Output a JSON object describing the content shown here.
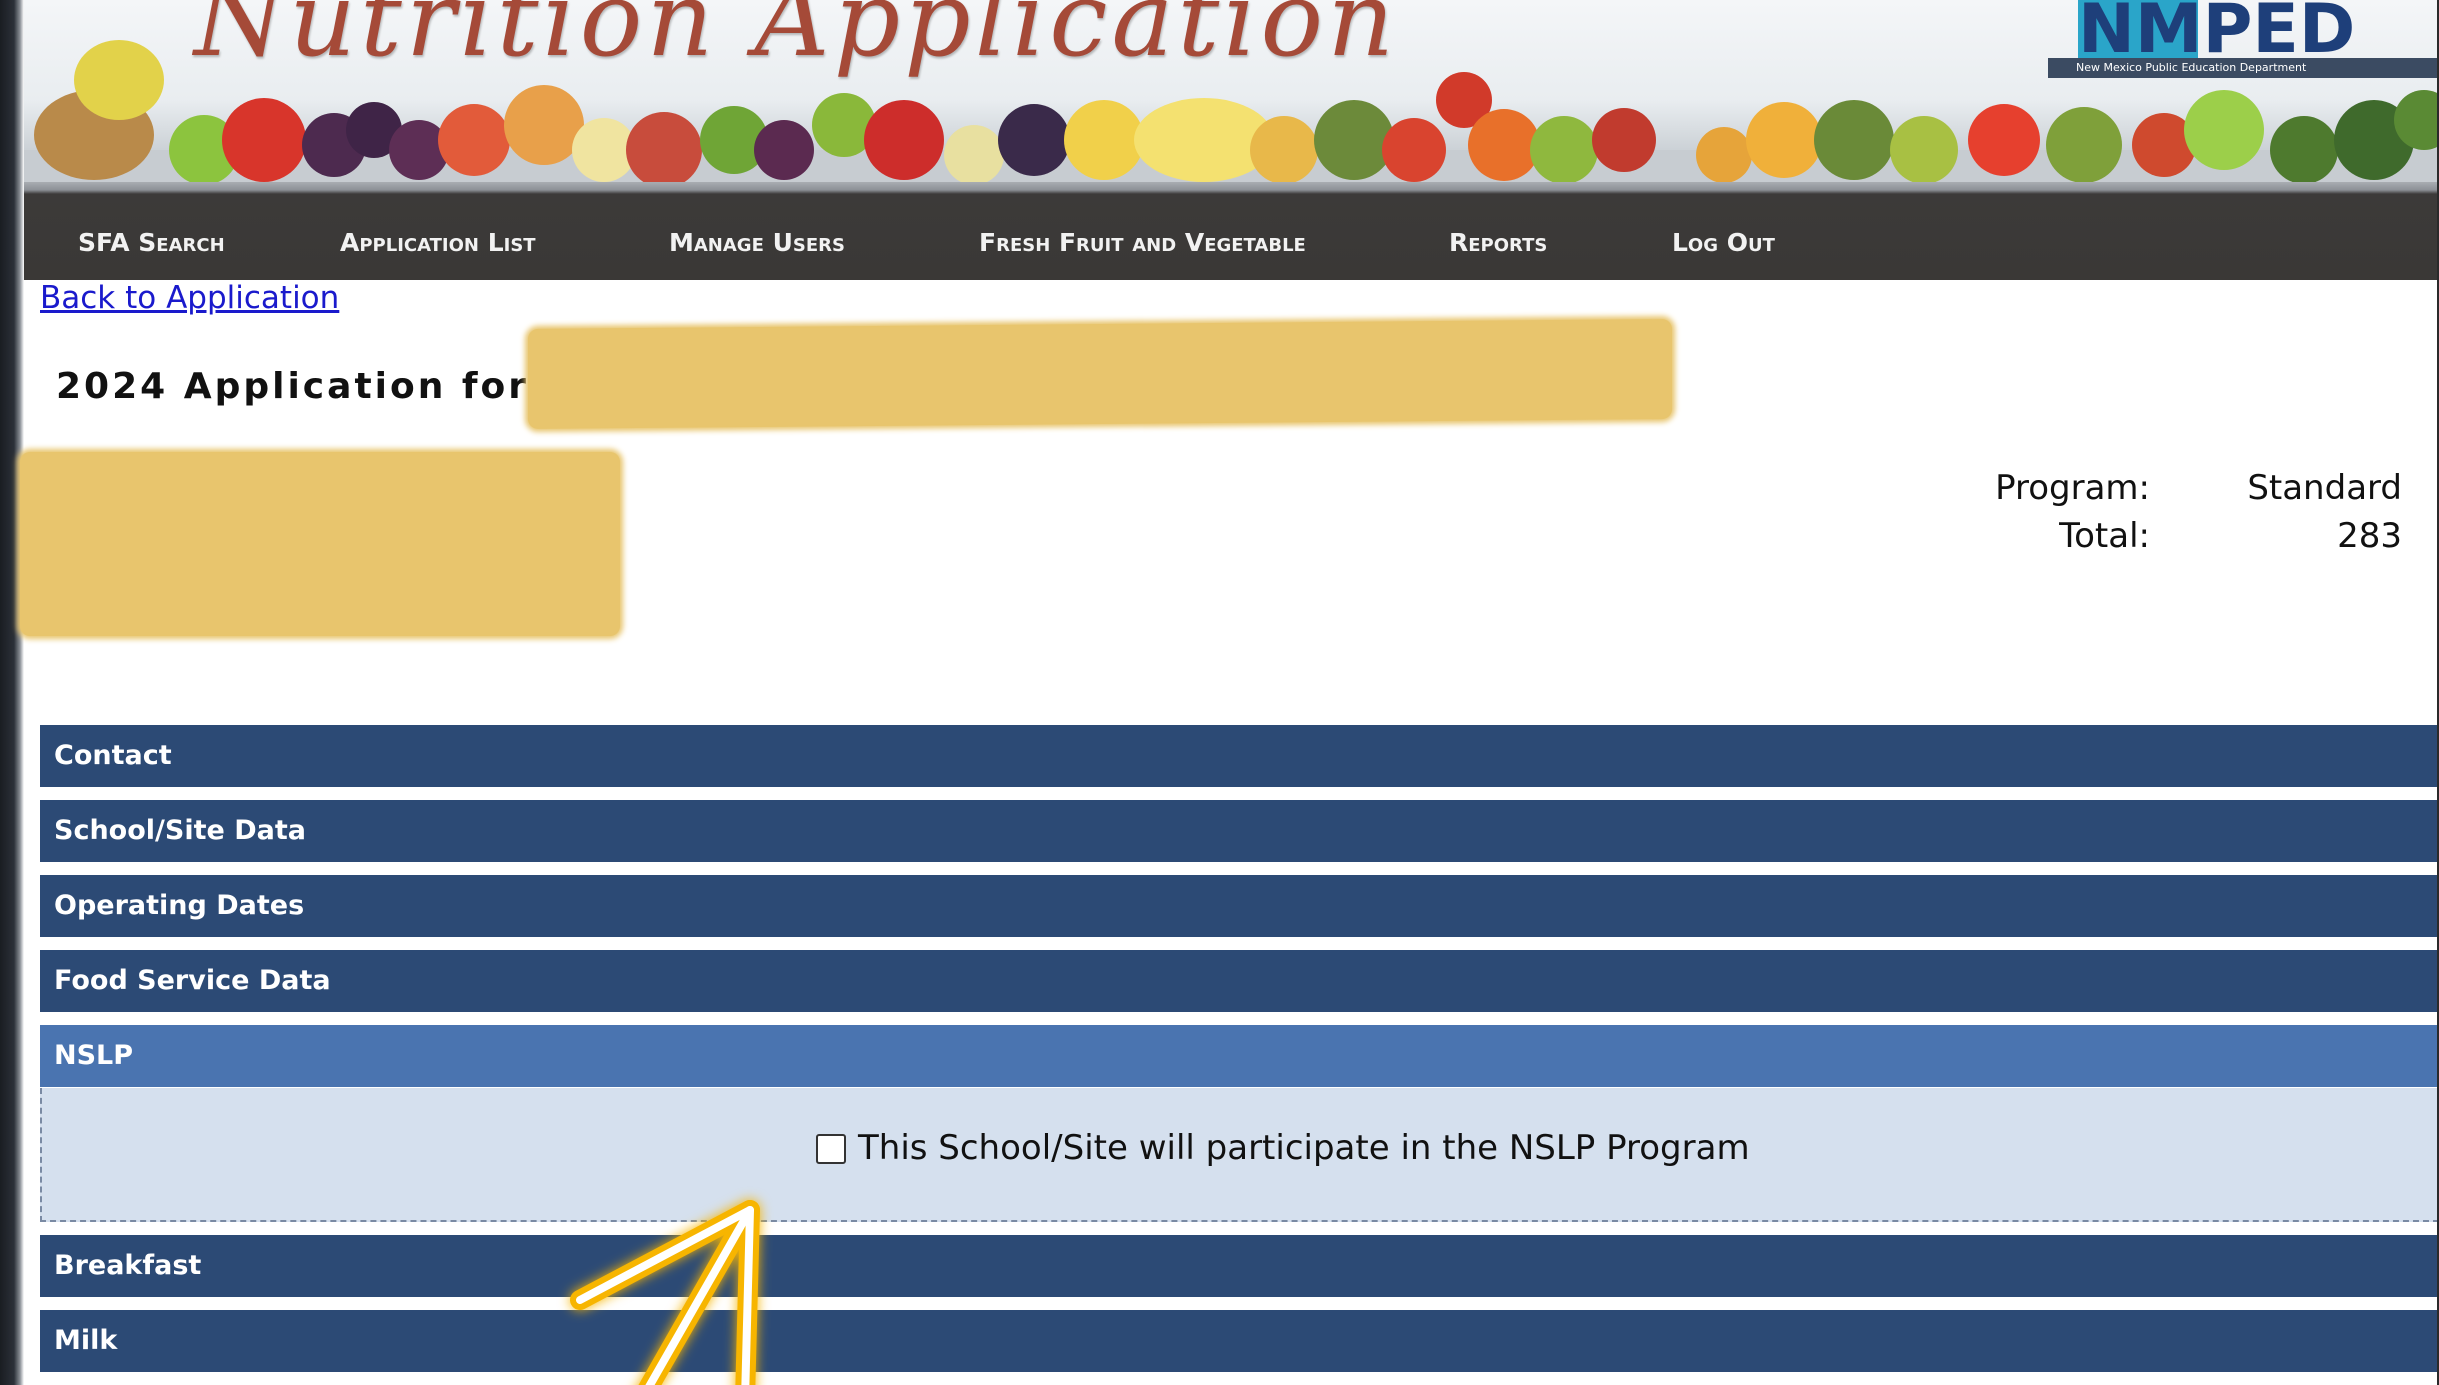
{
  "banner": {
    "title": "Nutrition Application",
    "logo_text": "NMPED",
    "logo_subtitle": "New Mexico Public Education Department"
  },
  "nav": {
    "items": [
      {
        "label": "SFA Search"
      },
      {
        "label": "Application List"
      },
      {
        "label": "Manage Users"
      },
      {
        "label": "Fresh Fruit and Vegetable"
      },
      {
        "label": "Reports"
      },
      {
        "label": "Log Out"
      }
    ]
  },
  "back_link": "Back to Application",
  "heading": "2024 Application for",
  "summary": {
    "program_label": "Program:",
    "program_value": "Standard",
    "total_label": "Total:",
    "total_value": "283"
  },
  "sections": [
    {
      "label": "Contact"
    },
    {
      "label": "School/Site Data"
    },
    {
      "label": "Operating Dates"
    },
    {
      "label": "Food Service Data"
    },
    {
      "label": "NSLP",
      "active": true
    },
    {
      "label": "Breakfast"
    },
    {
      "label": "Milk"
    }
  ],
  "nslp": {
    "checkbox_label": "This School/Site will participate in the NSLP Program",
    "checked": false
  },
  "colors": {
    "nav_bg": "#3a3836",
    "section_bg": "#2c4a75",
    "section_active_bg": "#4a74b0",
    "panel_bg": "#d5e0ee",
    "redaction": "#e8c56d",
    "arrow": "#f7b500",
    "link": "#1a1acc"
  }
}
